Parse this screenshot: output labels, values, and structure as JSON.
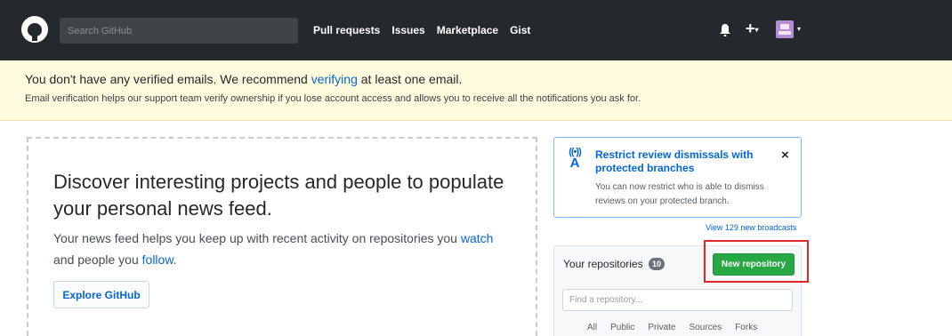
{
  "header": {
    "search_placeholder": "Search GitHub",
    "nav": [
      "Pull requests",
      "Issues",
      "Marketplace",
      "Gist"
    ],
    "plus_label": "+",
    "caret": "▾"
  },
  "flash": {
    "title_before": "You don't have any verified emails. We recommend ",
    "title_link": "verifying",
    "title_after": " at least one email.",
    "subtitle": "Email verification helps our support team verify ownership if you lose account access and allows you to receive all the notifications you ask for."
  },
  "discover": {
    "heading": "Discover interesting projects and people to populate your personal news feed.",
    "text_before": "Your news feed helps you keep up with recent activity on repositories you ",
    "link_watch": "watch",
    "text_middle": " and people you ",
    "link_follow": "follow",
    "text_after": ".",
    "button": "Explore GitHub"
  },
  "broadcast": {
    "icon_waves": "((•))",
    "icon_letter": "A",
    "title": "Restrict review dismissals with protected branches",
    "close": "×",
    "text": "You can now restrict who is able to dismiss reviews on your protected branch.",
    "view_all": "View 129 new broadcasts"
  },
  "repositories": {
    "title": "Your repositories",
    "count": "10",
    "new_button": "New repository",
    "filter_placeholder": "Find a repository...",
    "tabs": [
      "All",
      "Public",
      "Private",
      "Sources",
      "Forks"
    ]
  },
  "colors": {
    "header_bg": "#24292e",
    "flash_bg": "#fffbdd",
    "link": "#0366d6",
    "new_button": "#28a745",
    "highlight": "#e3262d"
  }
}
